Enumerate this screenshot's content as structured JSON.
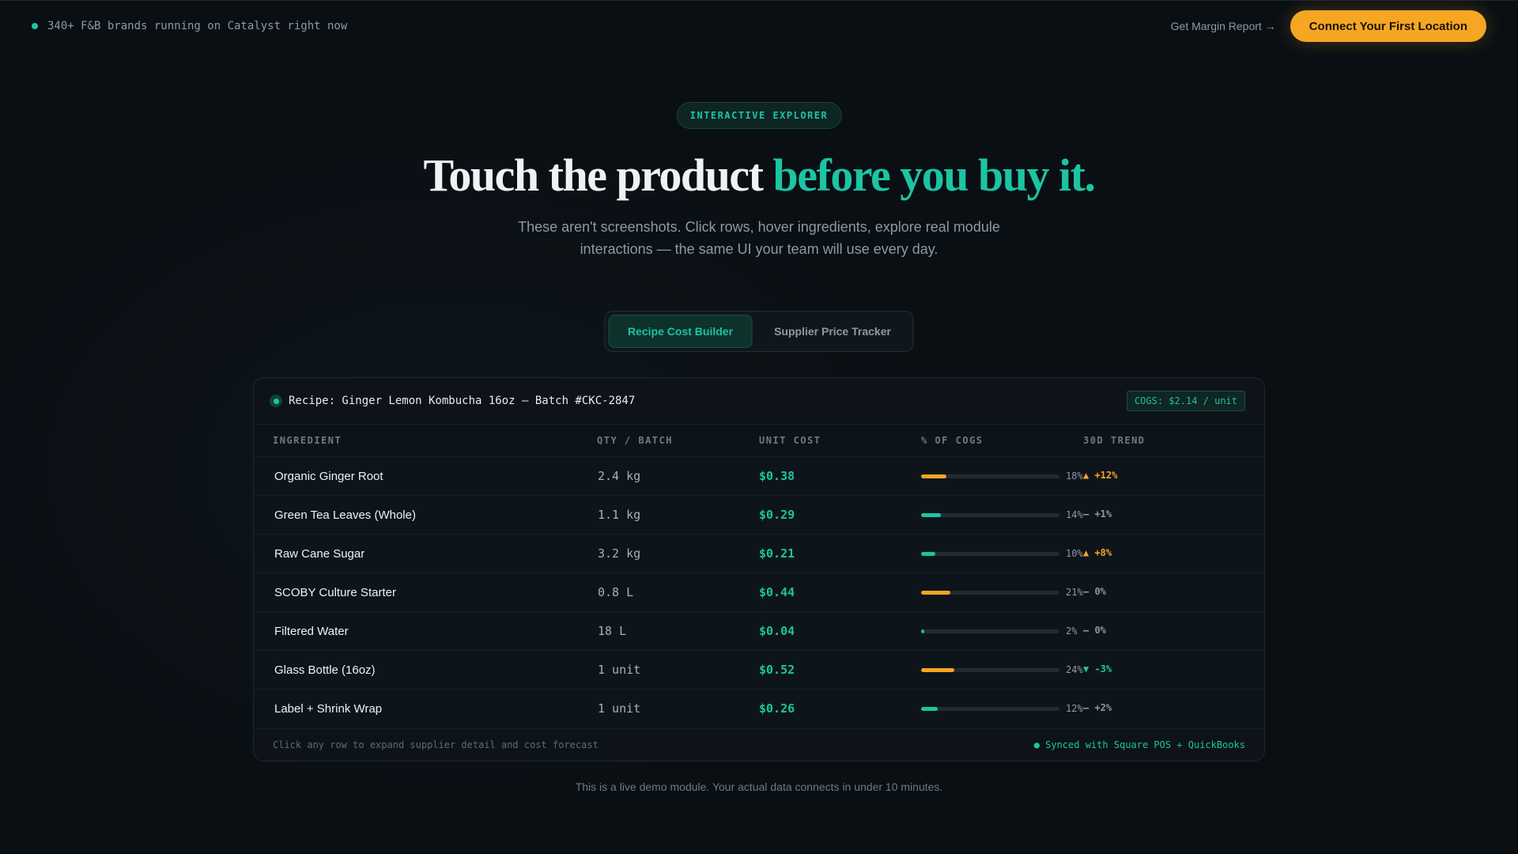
{
  "topbar": {
    "announcement": "340+ F&B brands running on Catalyst right now",
    "margin_link": "Get Margin Report →",
    "cta": "Connect Your First Location"
  },
  "hero": {
    "pill": "INTERACTIVE EXPLORER",
    "title_main": "Touch the product ",
    "title_accent": "before you buy it.",
    "subtitle": "These aren't screenshots. Click rows, hover ingredients, explore real module interactions — the same UI your team will use every day."
  },
  "tabs": [
    {
      "label": "Recipe Cost Builder",
      "active": true
    },
    {
      "label": "Supplier Price Tracker",
      "active": false
    }
  ],
  "panel": {
    "recipe_title": "Recipe: Ginger Lemon Kombucha 16oz — Batch #CKC-2847",
    "cogs_badge": "COGS: $2.14 / unit",
    "columns": [
      "INGREDIENT",
      "QTY / BATCH",
      "UNIT COST",
      "% OF COGS",
      "30D TREND"
    ],
    "rows": [
      {
        "ingredient": "Organic Ginger Root",
        "qty": "2.4 kg",
        "cost": "$0.38",
        "pct": 18,
        "pct_label": "18%",
        "trend": "▲ +12%",
        "trend_dir": "up"
      },
      {
        "ingredient": "Green Tea Leaves (Whole)",
        "qty": "1.1 kg",
        "cost": "$0.29",
        "pct": 14,
        "pct_label": "14%",
        "trend": "— +1%",
        "trend_dir": "flat"
      },
      {
        "ingredient": "Raw Cane Sugar",
        "qty": "3.2 kg",
        "cost": "$0.21",
        "pct": 10,
        "pct_label": "10%",
        "trend": "▲ +8%",
        "trend_dir": "up"
      },
      {
        "ingredient": "SCOBY Culture Starter",
        "qty": "0.8 L",
        "cost": "$0.44",
        "pct": 21,
        "pct_label": "21%",
        "trend": "— 0%",
        "trend_dir": "flat"
      },
      {
        "ingredient": "Filtered Water",
        "qty": "18 L",
        "cost": "$0.04",
        "pct": 2,
        "pct_label": "2%",
        "trend": "— 0%",
        "trend_dir": "flat"
      },
      {
        "ingredient": "Glass Bottle (16oz)",
        "qty": "1 unit",
        "cost": "$0.52",
        "pct": 24,
        "pct_label": "24%",
        "trend": "▼ -3%",
        "trend_dir": "down"
      },
      {
        "ingredient": "Label + Shrink Wrap",
        "qty": "1 unit",
        "cost": "$0.26",
        "pct": 12,
        "pct_label": "12%",
        "trend": "— +2%",
        "trend_dir": "flat"
      }
    ],
    "footer_hint": "Click any row to expand supplier detail and cost forecast",
    "footer_sync": "● Synced with Square POS + QuickBooks"
  },
  "footnote": "This is a live demo module. Your actual data connects in under 10 minutes.",
  "colors": {
    "accent": "#1cc4a3",
    "warning": "#f5a623",
    "background": "#0a0f14"
  }
}
